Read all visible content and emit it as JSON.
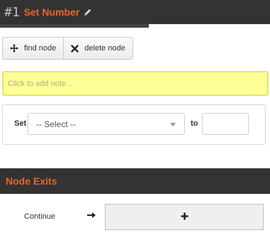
{
  "node": {
    "number": "#1",
    "title": "Set Number"
  },
  "toolbar": {
    "find_label": "find node",
    "find_icon": "crosshair-move-icon",
    "delete_label": "delete node",
    "delete_icon": "x-icon"
  },
  "note": {
    "placeholder": "Click to add note..."
  },
  "set_action": {
    "set_label": "Set",
    "select_value": "-- Select --",
    "to_label": "to",
    "to_value": ""
  },
  "exits": {
    "title": "Node Exits",
    "items": [
      {
        "label": "Continue",
        "add_icon": "plus-icon",
        "arrow_icon": "arrow-right-icon"
      }
    ]
  },
  "colors": {
    "header_bg": "#333333",
    "accent": "#e8642a",
    "note_bg": "#ffff99"
  }
}
